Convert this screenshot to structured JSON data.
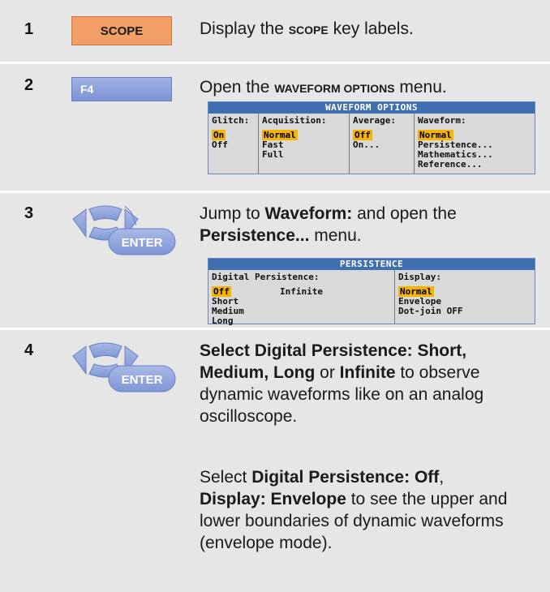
{
  "steps": [
    {
      "number": "1",
      "key_label": "SCOPE"
    },
    {
      "number": "2",
      "key_label": "F4"
    },
    {
      "number": "3",
      "key_label": "ENTER"
    },
    {
      "number": "4",
      "key_label": "ENTER"
    }
  ],
  "step1": {
    "pre": "Display the ",
    "bold": "SCOPE",
    "post": " key labels."
  },
  "step2": {
    "pre": "Open the ",
    "bold": "WAVEFORM OPTIONS",
    "post": " menu."
  },
  "step3": {
    "pre": "Jump to ",
    "bold1": "Waveform:",
    "mid": " and open the ",
    "bold2": "Persistence...",
    "post": " menu."
  },
  "step4": {
    "p1_b1": "Select Digital Persistence: Short,",
    "p1_b2": "Medium, Long",
    "p1_t1": " or ",
    "p1_b3": "Infinite",
    "p1_t2": " to observe dynamic waveforms like on an analog oscilloscope.",
    "p2_t1": "Select ",
    "p2_b1": "Digital Persistence: Off",
    "p2_t2": ",",
    "p2_b2": "Display: Envelope",
    "p2_t3": " to see the upper and lower boundaries of dynamic waveforms (envelope mode)."
  },
  "waveform_menu": {
    "title": "WAVEFORM OPTIONS",
    "glitch": {
      "heading": "Glitch:",
      "options": [
        "On",
        "Off"
      ]
    },
    "acquisition": {
      "heading": "Acquisition:",
      "options": [
        "Normal",
        "Fast",
        "Full"
      ]
    },
    "average": {
      "heading": "Average:",
      "options": [
        "Off",
        "On..."
      ]
    },
    "waveform": {
      "heading": "Waveform:",
      "options": [
        "Normal",
        "Persistence...",
        "Mathematics...",
        "Reference..."
      ]
    }
  },
  "persistence_menu": {
    "title": "PERSISTENCE",
    "digital": {
      "heading": "Digital Persistence:",
      "options": [
        "Off",
        "Short",
        "Medium",
        "Long"
      ],
      "infinite": "Infinite"
    },
    "display": {
      "heading": "Display:",
      "options": [
        "Normal",
        "Envelope",
        "Dot-join OFF"
      ]
    }
  },
  "colors": {
    "scope_key": "#f19e67",
    "f4_key": "#8ea3dd",
    "menu_title": "#3f6fb0",
    "selected": "#f5b400",
    "row_bg": "#e6e6e6"
  }
}
